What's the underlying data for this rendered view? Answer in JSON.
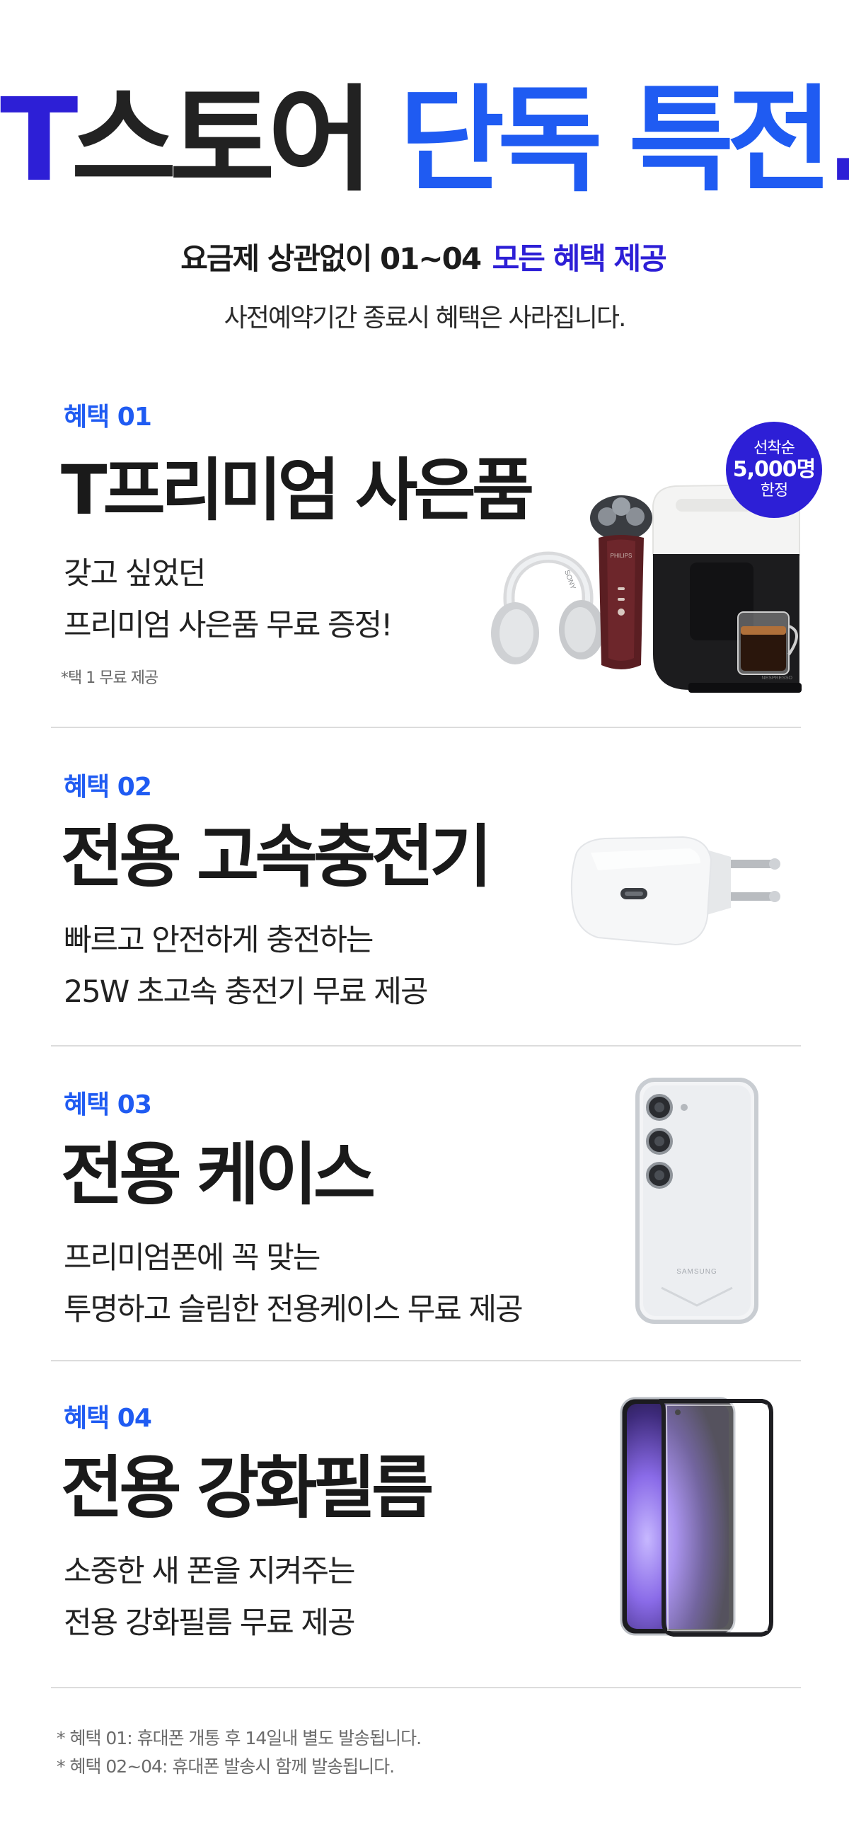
{
  "hero": {
    "title_brand": "T",
    "title_dark": "스토어 ",
    "title_blue": "단독 특전",
    "title_dot": ".",
    "subtitle_plain": "요금제 상관없이 01~04 ",
    "subtitle_highlight": "모든 혜택 제공",
    "note": "사전예약기간 종료시 혜택은 사라집니다."
  },
  "benefits": [
    {
      "label": "혜택 01",
      "title": "T프리미엄 사은품",
      "desc_line1": "갖고 싶었던",
      "desc_line2": "프리미엄 사은품 무료 증정!",
      "small_note": "*택 1 무료 제공",
      "badge": {
        "line1": "선착순",
        "line2": "5,000명",
        "line3": "한정"
      },
      "image_brands": {
        "headphones": "SONY",
        "shaver": "PHILIPS",
        "coffee": "NESPRESSO"
      }
    },
    {
      "label": "혜택 02",
      "title": "전용 고속충전기",
      "desc_line1": "빠르고 안전하게 충전하는",
      "desc_line2": "25W 초고속 충전기 무료 제공"
    },
    {
      "label": "혜택 03",
      "title": "전용 케이스",
      "desc_line1": "프리미엄폰에 꼭 맞는",
      "desc_line2": "투명하고 슬림한 전용케이스 무료 제공",
      "image_brand": "SAMSUNG"
    },
    {
      "label": "혜택 04",
      "title": "전용 강화필름",
      "desc_line1": "소중한 새 폰을 지켜주는",
      "desc_line2": "전용 강화필름 무료 제공"
    }
  ],
  "footnotes": [
    "* 혜택 01: 휴대폰 개통 후 14일내 별도 발송됩니다.",
    "* 혜택 02~04: 휴대폰 발송시 함께 발송됩니다."
  ],
  "colors": {
    "brand_purple": "#2d1fd6",
    "accent_blue": "#1f5bf2",
    "highlight_yellow": "#e6f53a",
    "text_dark": "#1a1a1a",
    "divider": "#dcdcdc"
  }
}
